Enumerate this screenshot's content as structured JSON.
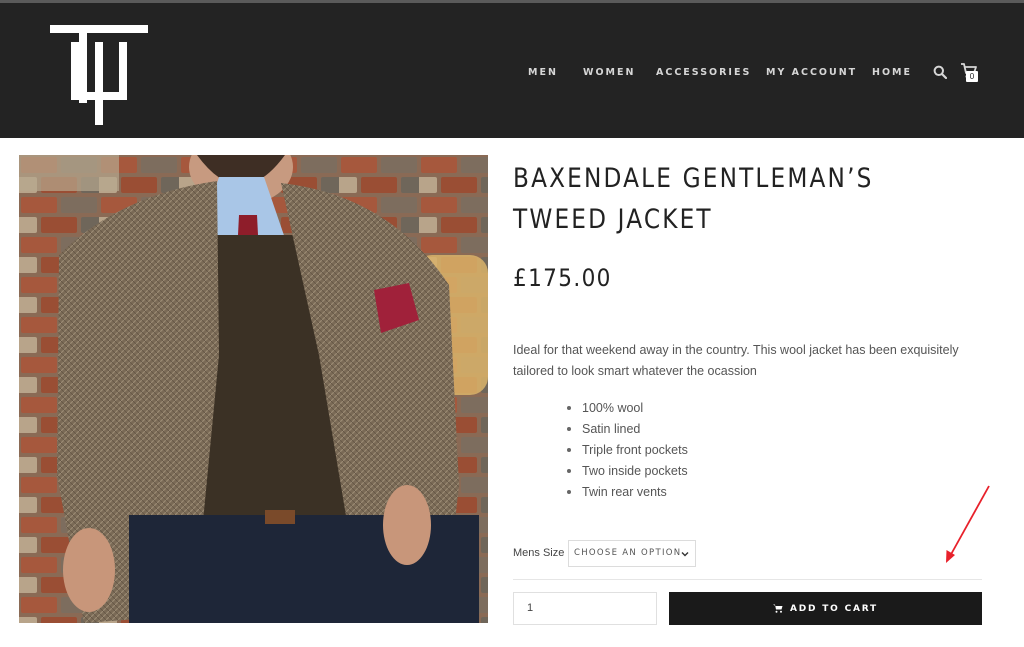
{
  "header": {
    "nav": [
      {
        "label": "MEN"
      },
      {
        "label": "WOMEN"
      },
      {
        "label": "ACCESSORIES"
      },
      {
        "label": "MY ACCOUNT"
      },
      {
        "label": "HOME"
      }
    ],
    "cart_count": "0",
    "logo_icon": "trident-logo",
    "search_icon": "search-icon",
    "cart_icon": "shopping-cart-icon"
  },
  "product": {
    "title_line1": "BAXENDALE GENTLEMAN’S",
    "title_line2": "TWEED JACKET",
    "price": "£175.00",
    "description": "Ideal for that weekend away in the country. This wool jacket has been exquisitely tailored to look smart whatever the ocassion",
    "features": [
      "100% wool",
      "Satin lined",
      "Triple front pockets",
      "Two inside pockets",
      "Twin rear vents"
    ],
    "size_label": "Mens Size",
    "size_select": "CHOOSE AN OPTION",
    "quantity": "1",
    "add_to_cart": "ADD TO CART"
  },
  "colors": {
    "header_bg": "#232323",
    "button_bg": "#1a1a1a",
    "annotation_arrow": "#e8212b"
  }
}
